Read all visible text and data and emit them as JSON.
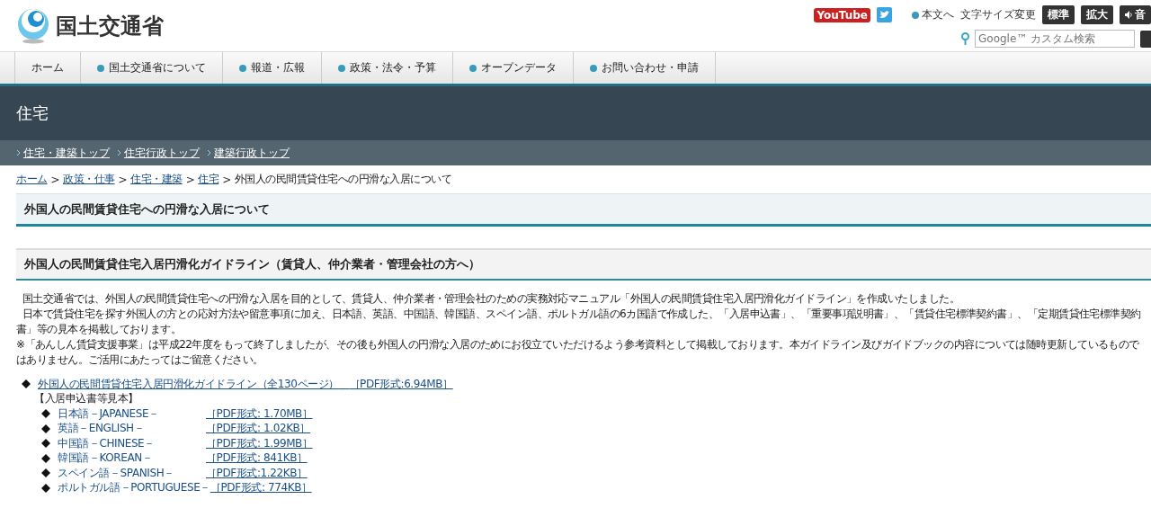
{
  "header": {
    "site_name": "国土交通省",
    "youtube": "YouTube",
    "skip_link": "本文へ",
    "font_size_label": "文字サイズ変更",
    "font_buttons": [
      {
        "label": "標準",
        "selected": false
      },
      {
        "label": "拡大",
        "selected": false
      }
    ],
    "voice_button": "音",
    "search": {
      "placeholder": "Google™ カスタム検索"
    }
  },
  "nav": [
    {
      "label": "ホーム",
      "bullet": false
    },
    {
      "label": "国土交通省について",
      "bullet": true
    },
    {
      "label": "報道・広報",
      "bullet": true
    },
    {
      "label": "政策・法令・予算",
      "bullet": true
    },
    {
      "label": "オープンデータ",
      "bullet": true
    },
    {
      "label": "お問い合わせ・申請",
      "bullet": true
    }
  ],
  "banner": {
    "title": "住宅"
  },
  "subnav": [
    "住宅・建築トップ",
    "住宅行政トップ",
    "建築行政トップ"
  ],
  "breadcrumb": {
    "links": [
      {
        "label": "ホーム",
        "separator": ">"
      },
      {
        "label": "政策・仕事",
        "separator": ">"
      },
      {
        "label": "住宅・建築",
        "separator": ">"
      },
      {
        "label": "住宅",
        "separator": ">"
      }
    ],
    "current": "外国人の民間賃貸住宅への円滑な入居について"
  },
  "page_title": "外国人の民間賃貸住宅への円滑な入居について",
  "section_title": "外国人の民間賃貸住宅入居円滑化ガイドライン（賃貸人、仲介業者・管理会社の方へ）",
  "paragraphs": [
    "国土交通省では、外国人の民間賃貸住宅への円滑な入居を目的として、賃貸人、仲介業者・管理会社のための実務対応マニュアル「外国人の民間賃貸住宅入居円滑化ガイドライン」を作成いたしました。",
    "日本で賃貸住宅を探す外国人の方との応対方法や留意事項に加え、日本語、英語、中国語、韓国語、スペイン語、ポルトガル語の6カ国語で作成した、「入居申込書」、「重要事項説明書」、「賃貸住宅標準契約書」、「定期賃貸住宅標準契約書」等の見本を掲載しております。",
    "※「あんしん賃貸支援事業」は平成22年度をもって終了しましたが、その後も外国人の円滑な入居のためにお役立ていただけるよう参考資料として掲載しております。本ガイドライン及びガイドブックの内容については随時更新しているものではありません。ご活用にあたってはご留意ください。"
  ],
  "main_link": {
    "name": "外国人の民間賃貸住宅入居円滑化ガイドライン（全130ページ）",
    "size": "［PDF形式:6.94MB］"
  },
  "samples_heading": "【入居申込書等見本】",
  "samples": [
    {
      "name": "日本語－JAPANESE－",
      "size": "［PDF形式: 1.70MB］"
    },
    {
      "name": "英語－ENGLISH－",
      "size": "［PDF形式: 1.02KB］"
    },
    {
      "name": "中国語－CHINESE－",
      "size": "［PDF形式: 1.99MB］"
    },
    {
      "name": "韓国語－KOREAN－",
      "size": "［PDF形式: 841KB］"
    },
    {
      "name": "スペイン語－SPANISH－",
      "size": "［PDF形式:1.22KB］"
    },
    {
      "name": "ポルトガル語－PORTUGUESE－",
      "size": "［PDF形式: 774KB］"
    }
  ]
}
